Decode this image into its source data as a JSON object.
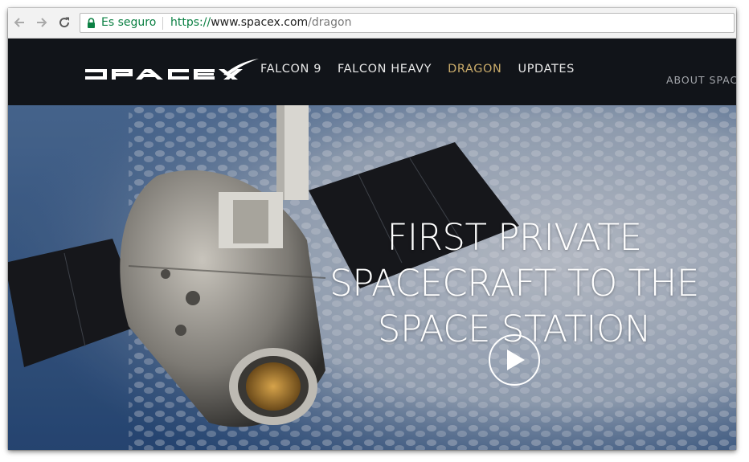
{
  "browser": {
    "security_label": "Es seguro",
    "url_scheme": "https://",
    "url_host": "www.spacex.com",
    "url_path": "/dragon"
  },
  "site": {
    "logo_alt": "SPACEX",
    "nav": [
      {
        "label": "FALCON 9",
        "active": false
      },
      {
        "label": "FALCON HEAVY",
        "active": false
      },
      {
        "label": "DRAGON",
        "active": true
      },
      {
        "label": "UPDATES",
        "active": false
      }
    ],
    "about_label": "ABOUT SPAC"
  },
  "hero": {
    "title_lines": [
      "FIRST PRIVATE",
      "SPACECRAFT TO THE",
      "SPACE STATION"
    ]
  },
  "colors": {
    "header_bg": "#111419",
    "nav_text": "#e8e8e8",
    "nav_active": "#c9ab6a",
    "secure_green": "#0b8043"
  }
}
